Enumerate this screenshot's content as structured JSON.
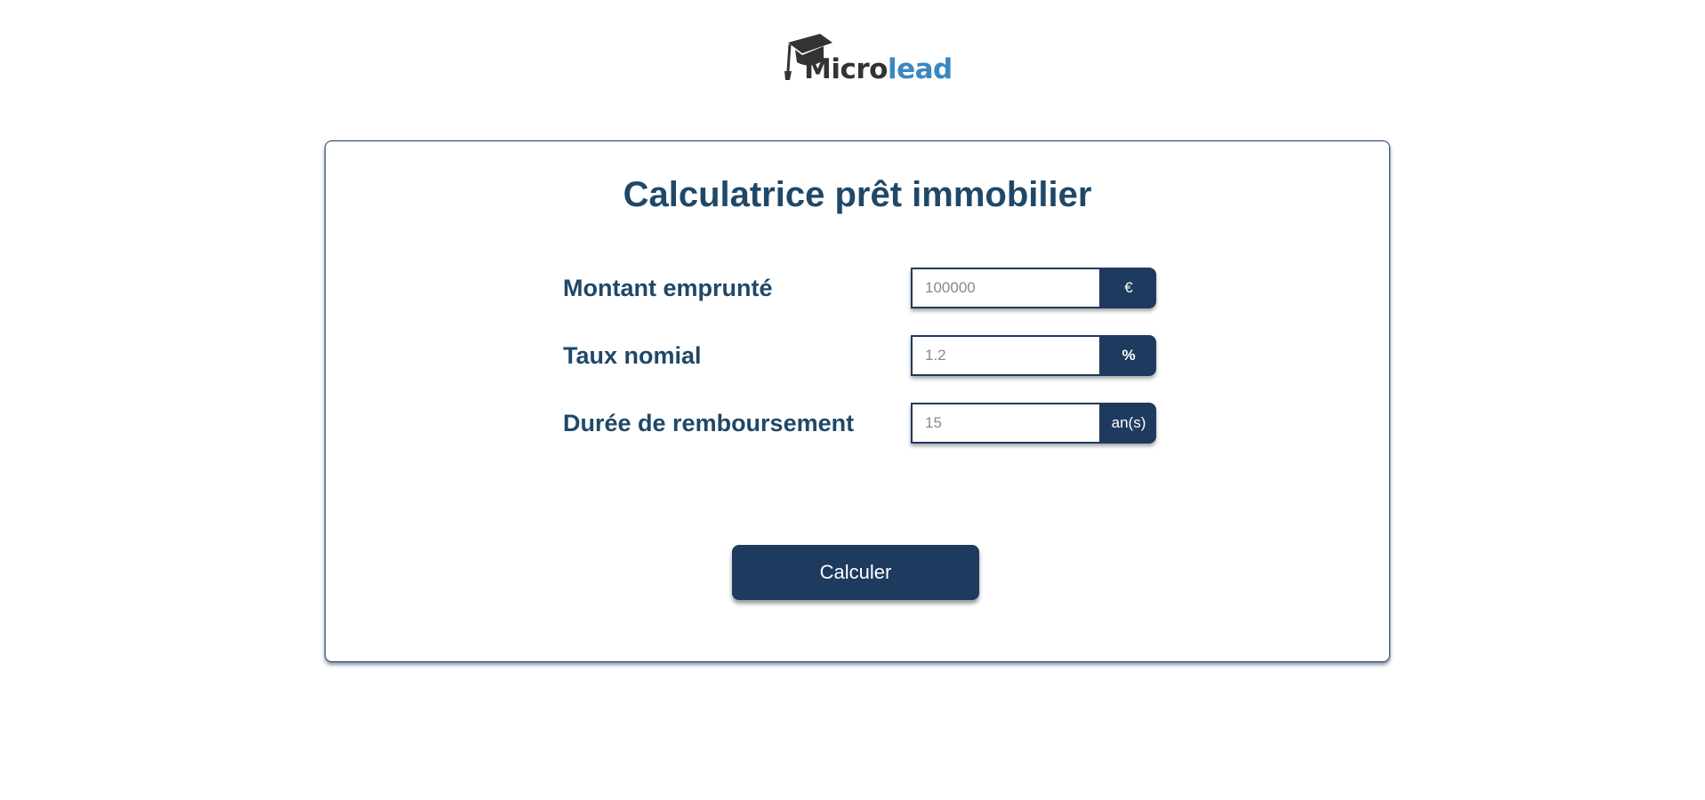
{
  "brand": {
    "logo_part1": "Micro",
    "logo_part2": "lead",
    "accent_color": "#3a87c2",
    "dark_color": "#333333",
    "icon": "graduation-cap-icon"
  },
  "calculator": {
    "title": "Calculatrice prêt immobilier",
    "primary_color": "#1f3a5f",
    "fields": [
      {
        "label": "Montant emprunté",
        "value": "",
        "placeholder": "100000",
        "unit": "€"
      },
      {
        "label": "Taux nomial",
        "value": "",
        "placeholder": "1.2",
        "unit": "%"
      },
      {
        "label": "Durée de remboursement",
        "value": "",
        "placeholder": "15",
        "unit": "an(s)"
      }
    ],
    "submit_label": "Calculer"
  }
}
